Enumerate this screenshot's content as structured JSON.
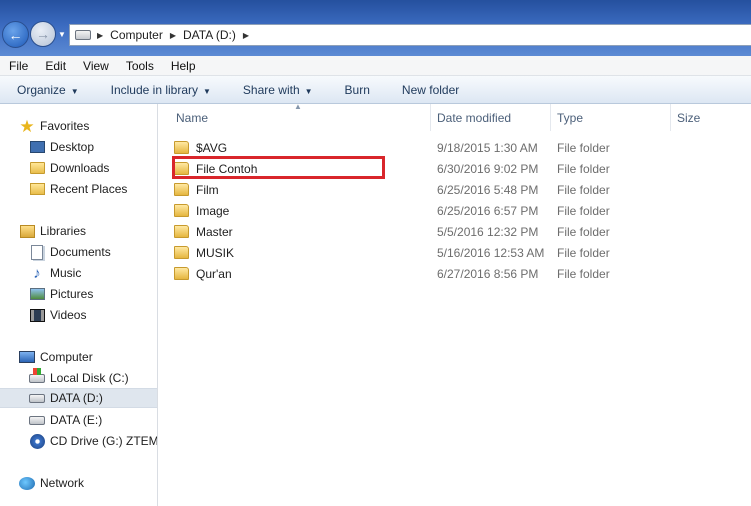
{
  "address": {
    "crumbs": [
      "Computer",
      "DATA (D:)"
    ]
  },
  "menu": [
    "File",
    "Edit",
    "View",
    "Tools",
    "Help"
  ],
  "toolbar": [
    {
      "label": "Organize",
      "dropdown": true
    },
    {
      "label": "Include in library",
      "dropdown": true
    },
    {
      "label": "Share with",
      "dropdown": true
    },
    {
      "label": "Burn",
      "dropdown": false
    },
    {
      "label": "New folder",
      "dropdown": false
    }
  ],
  "nav": {
    "favorites": {
      "label": "Favorites",
      "items": [
        "Desktop",
        "Downloads",
        "Recent Places"
      ]
    },
    "libraries": {
      "label": "Libraries",
      "items": [
        "Documents",
        "Music",
        "Pictures",
        "Videos"
      ]
    },
    "computer": {
      "label": "Computer",
      "items": [
        "Local Disk (C:)",
        "DATA (D:)",
        "DATA (E:)",
        "CD Drive (G:) ZTEMC"
      ]
    },
    "network": {
      "label": "Network"
    }
  },
  "columns": {
    "name": "Name",
    "date": "Date modified",
    "type": "Type",
    "size": "Size"
  },
  "files": [
    {
      "name": "$AVG",
      "date": "9/18/2015 1:30 AM",
      "type": "File folder"
    },
    {
      "name": "File Contoh",
      "date": "6/30/2016 9:02 PM",
      "type": "File folder"
    },
    {
      "name": "Film",
      "date": "6/25/2016 5:48 PM",
      "type": "File folder"
    },
    {
      "name": "Image",
      "date": "6/25/2016 6:57 PM",
      "type": "File folder"
    },
    {
      "name": "Master",
      "date": "5/5/2016 12:32 PM",
      "type": "File folder"
    },
    {
      "name": "MUSIK",
      "date": "5/16/2016 12:53 AM",
      "type": "File folder"
    },
    {
      "name": "Qur'an",
      "date": "6/27/2016 8:56 PM",
      "type": "File folder"
    }
  ],
  "colors": {
    "highlight": "#d9262b",
    "selected_nav": "#dfe6ee"
  }
}
